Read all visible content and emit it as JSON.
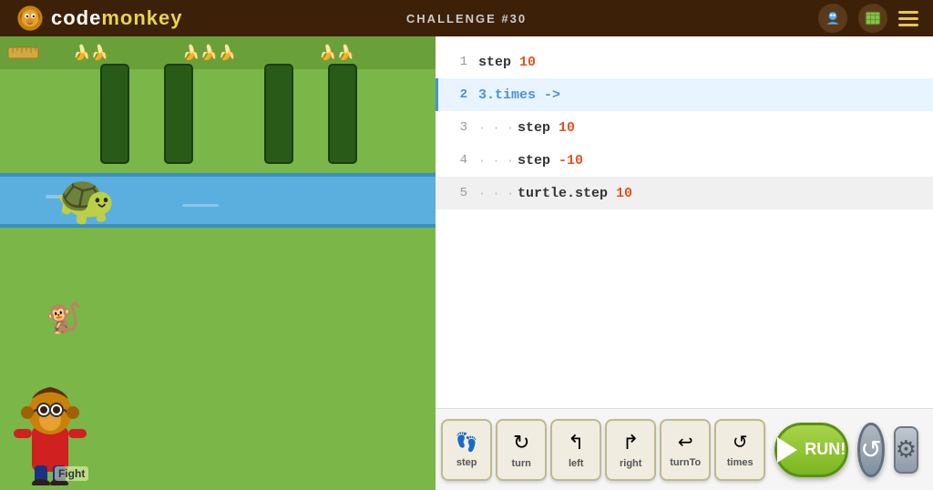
{
  "header": {
    "logo_text_code": "code",
    "logo_text_monkey": "monkey",
    "challenge_label": "CHALLENGE #30",
    "nav_icons": [
      "avatar",
      "map",
      "menu"
    ]
  },
  "code_editor": {
    "lines": [
      {
        "num": "1",
        "active": false,
        "indent": "",
        "content_parts": [
          {
            "type": "plain",
            "text": "step "
          },
          {
            "type": "number",
            "text": "10"
          }
        ]
      },
      {
        "num": "2",
        "active": true,
        "indent": "",
        "content_parts": [
          {
            "type": "method",
            "text": "3.times "
          },
          {
            "type": "arrow",
            "text": "->"
          }
        ]
      },
      {
        "num": "3",
        "active": false,
        "indent": "· · · ",
        "content_parts": [
          {
            "type": "plain",
            "text": "step "
          },
          {
            "type": "number",
            "text": "10"
          }
        ]
      },
      {
        "num": "4",
        "active": false,
        "indent": "· · · ",
        "content_parts": [
          {
            "type": "plain",
            "text": "step "
          },
          {
            "type": "neg",
            "text": "-10"
          }
        ]
      },
      {
        "num": "5",
        "active": false,
        "indent": "· · · ",
        "content_parts": [
          {
            "type": "plain",
            "text": "turtle.step "
          },
          {
            "type": "number",
            "text": "10"
          }
        ]
      }
    ]
  },
  "toolbar": {
    "run_label": "RUN!",
    "commands": [
      {
        "icon": "👣",
        "label": "step"
      },
      {
        "icon": "↻",
        "label": "turn"
      },
      {
        "icon": "←",
        "label": "left"
      },
      {
        "icon": "→",
        "label": "right"
      },
      {
        "icon": "↩",
        "label": "turnTo"
      },
      {
        "icon": "↺",
        "label": "times"
      }
    ]
  },
  "game": {
    "monkey_label": "Fight",
    "bananas_top": "🍌🍌🍌",
    "scene_description": "grass field with river, turtle, and monkey characters"
  }
}
